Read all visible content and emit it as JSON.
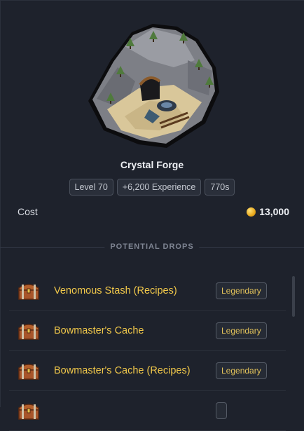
{
  "building": {
    "name": "Crystal Forge",
    "chips": [
      "Level 70",
      "+6,200 Experience",
      "770s"
    ]
  },
  "cost": {
    "label": "Cost",
    "value": "13,000",
    "icon": "gold-coin-icon"
  },
  "drops": {
    "heading": "POTENTIAL DROPS",
    "items": [
      {
        "name": "Venomous Stash (Recipes)",
        "rarity": "Legendary",
        "icon": "treasure-chest-icon"
      },
      {
        "name": "Bowmaster's Cache",
        "rarity": "Legendary",
        "icon": "treasure-chest-icon"
      },
      {
        "name": "Bowmaster's Cache (Recipes)",
        "rarity": "Legendary",
        "icon": "treasure-chest-icon"
      },
      {
        "name": "",
        "rarity": "",
        "icon": "treasure-chest-icon"
      }
    ]
  },
  "colors": {
    "background": "#1e222c",
    "item_name": "#f1c84a",
    "rarity_text": "#e2c25a"
  }
}
